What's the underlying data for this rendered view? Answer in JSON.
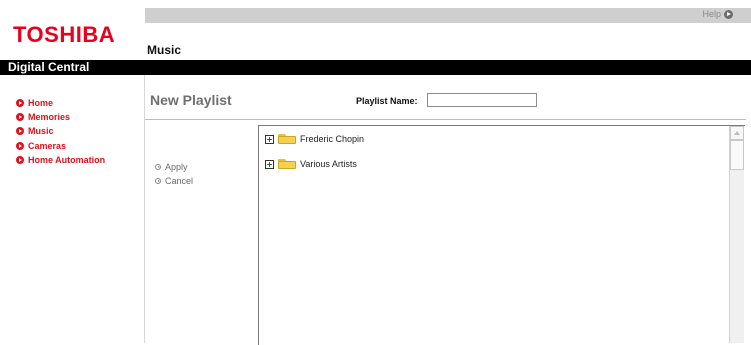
{
  "header": {
    "logo": "TOSHIBA",
    "brand_subtitle": "Digital Central",
    "section_title": "Music",
    "help_label": "Help"
  },
  "sidebar": {
    "items": [
      {
        "label": "Home"
      },
      {
        "label": "Memories"
      },
      {
        "label": "Music"
      },
      {
        "label": "Cameras"
      },
      {
        "label": "Home Automation"
      }
    ]
  },
  "main": {
    "page_heading": "New Playlist",
    "playlist_name_label": "Playlist Name:",
    "playlist_name_value": "",
    "actions": {
      "apply": "Apply",
      "cancel": "Cancel"
    },
    "tree": [
      {
        "label": "Frederic Chopin"
      },
      {
        "label": "Various Artists"
      }
    ]
  },
  "colors": {
    "brand_red": "#e8001c",
    "nav_red": "#e3101b",
    "header_bar": "#cfcfcf",
    "black_bar": "#000000",
    "folder": "#f6d24b"
  }
}
